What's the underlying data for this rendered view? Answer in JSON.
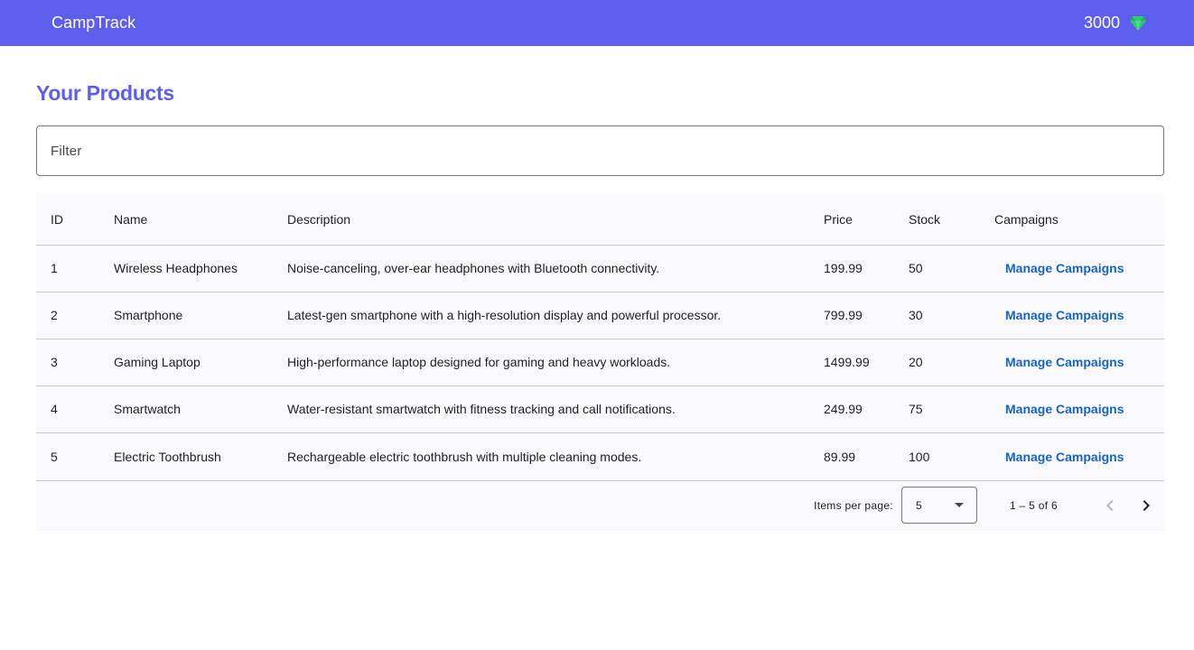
{
  "header": {
    "title": "CampTrack",
    "points": "3000",
    "gem_icon": "gem-icon",
    "gem_color": "#2ecc71",
    "bar_color": "#5c5fec"
  },
  "page": {
    "title": "Your Products"
  },
  "filter": {
    "placeholder": "Filter",
    "value": ""
  },
  "table": {
    "columns": [
      "ID",
      "Name",
      "Description",
      "Price",
      "Stock",
      "Campaigns"
    ],
    "rows": [
      {
        "id": "1",
        "name": "Wireless Headphones",
        "description": "Noise-canceling, over-ear headphones with Bluetooth connectivity.",
        "price": "199.99",
        "stock": "50",
        "action": "Manage Campaigns"
      },
      {
        "id": "2",
        "name": "Smartphone",
        "description": "Latest-gen smartphone with a high-resolution display and powerful processor.",
        "price": "799.99",
        "stock": "30",
        "action": "Manage Campaigns"
      },
      {
        "id": "3",
        "name": "Gaming Laptop",
        "description": "High-performance laptop designed for gaming and heavy workloads.",
        "price": "1499.99",
        "stock": "20",
        "action": "Manage Campaigns"
      },
      {
        "id": "4",
        "name": "Smartwatch",
        "description": "Water-resistant smartwatch with fitness tracking and call notifications.",
        "price": "249.99",
        "stock": "75",
        "action": "Manage Campaigns"
      },
      {
        "id": "5",
        "name": "Electric Toothbrush",
        "description": "Rechargeable electric toothbrush with multiple cleaning modes.",
        "price": "89.99",
        "stock": "100",
        "action": "Manage Campaigns"
      }
    ]
  },
  "paginator": {
    "items_per_page_label": "Items per page:",
    "items_per_page_value": "5",
    "range_label": "1 – 5 of 6",
    "prev_icon": "chevron-left-icon",
    "next_icon": "chevron-right-icon"
  }
}
